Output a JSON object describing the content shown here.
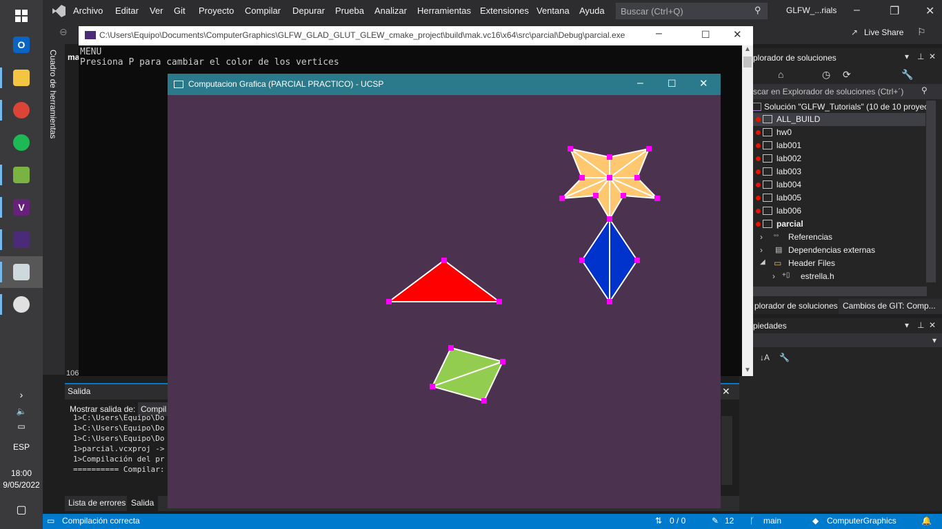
{
  "menubar": {
    "items": [
      "Archivo",
      "Editar",
      "Ver",
      "Git",
      "Proyecto",
      "Compilar",
      "Depurar",
      "Prueba",
      "Analizar",
      "Herramientas",
      "Extensiones",
      "Ventana",
      "Ayuda"
    ],
    "search_placeholder": "Buscar (Ctrl+Q)",
    "solution_name": "GLFW_...rials",
    "live_share": "Live Share"
  },
  "toolbox": {
    "label": "Cuadro de herramientas"
  },
  "console": {
    "title": "C:\\Users\\Equipo\\Documents\\ComputerGraphics\\GLFW_GLAD_GLUT_GLEW_cmake_project\\build\\mak.vc16\\x64\\src\\parcial\\Debug\\parcial.exe",
    "lines": [
      "MENU",
      "Presiona P para cambiar el color de los vertices"
    ]
  },
  "gl_window": {
    "title": "Computacion Grafica (PARCIAL PRACTICO) - UCSP",
    "background": "#4b324f",
    "vertex_color": "#ff00ff",
    "edge_color": "#ffffff",
    "shapes": {
      "triangle_color": "#ff0000",
      "diamond_color": "#0033cc",
      "star_color": "#ffc870",
      "quad_color": "#92cd4f"
    }
  },
  "solution_explorer": {
    "title": "plorador de soluciones",
    "search": "scar en Explorador de soluciones (Ctrl+´)",
    "solution": "Solución \"GLFW_Tutorials\" (10 de 10 proyecto",
    "projects": [
      "ALL_BUILD",
      "hw0",
      "lab001",
      "lab002",
      "lab003",
      "lab004",
      "lab005",
      "lab006",
      "parcial"
    ],
    "children": [
      "Referencias",
      "Dependencias externas",
      "Header Files",
      "estrella.h"
    ],
    "tabs": [
      "plorador de soluciones",
      "Cambios de GIT: Comp..."
    ]
  },
  "properties": {
    "title": "piedades"
  },
  "output": {
    "title": "Salida",
    "show_from_label": "Mostrar salida de:",
    "show_from_value": "Compil",
    "lines": [
      "1>C:\\Users\\Equipo\\Do",
      "1>C:\\Users\\Equipo\\Do",
      "1>C:\\Users\\Equipo\\Do",
      "1>parcial.vcxproj ->",
      "1>Compilación del pr",
      "========== Compilar:"
    ],
    "tabs": [
      "Lista de errores",
      "Salida"
    ],
    "line_number": "106"
  },
  "statusbar": {
    "message": "Compilación correcta",
    "changes": "0 / 0",
    "edits": "12",
    "branch": "main",
    "repo": "ComputerGraphics"
  },
  "tray": {
    "lang": "ESP",
    "time": "18:00",
    "date": "9/05/2022"
  }
}
